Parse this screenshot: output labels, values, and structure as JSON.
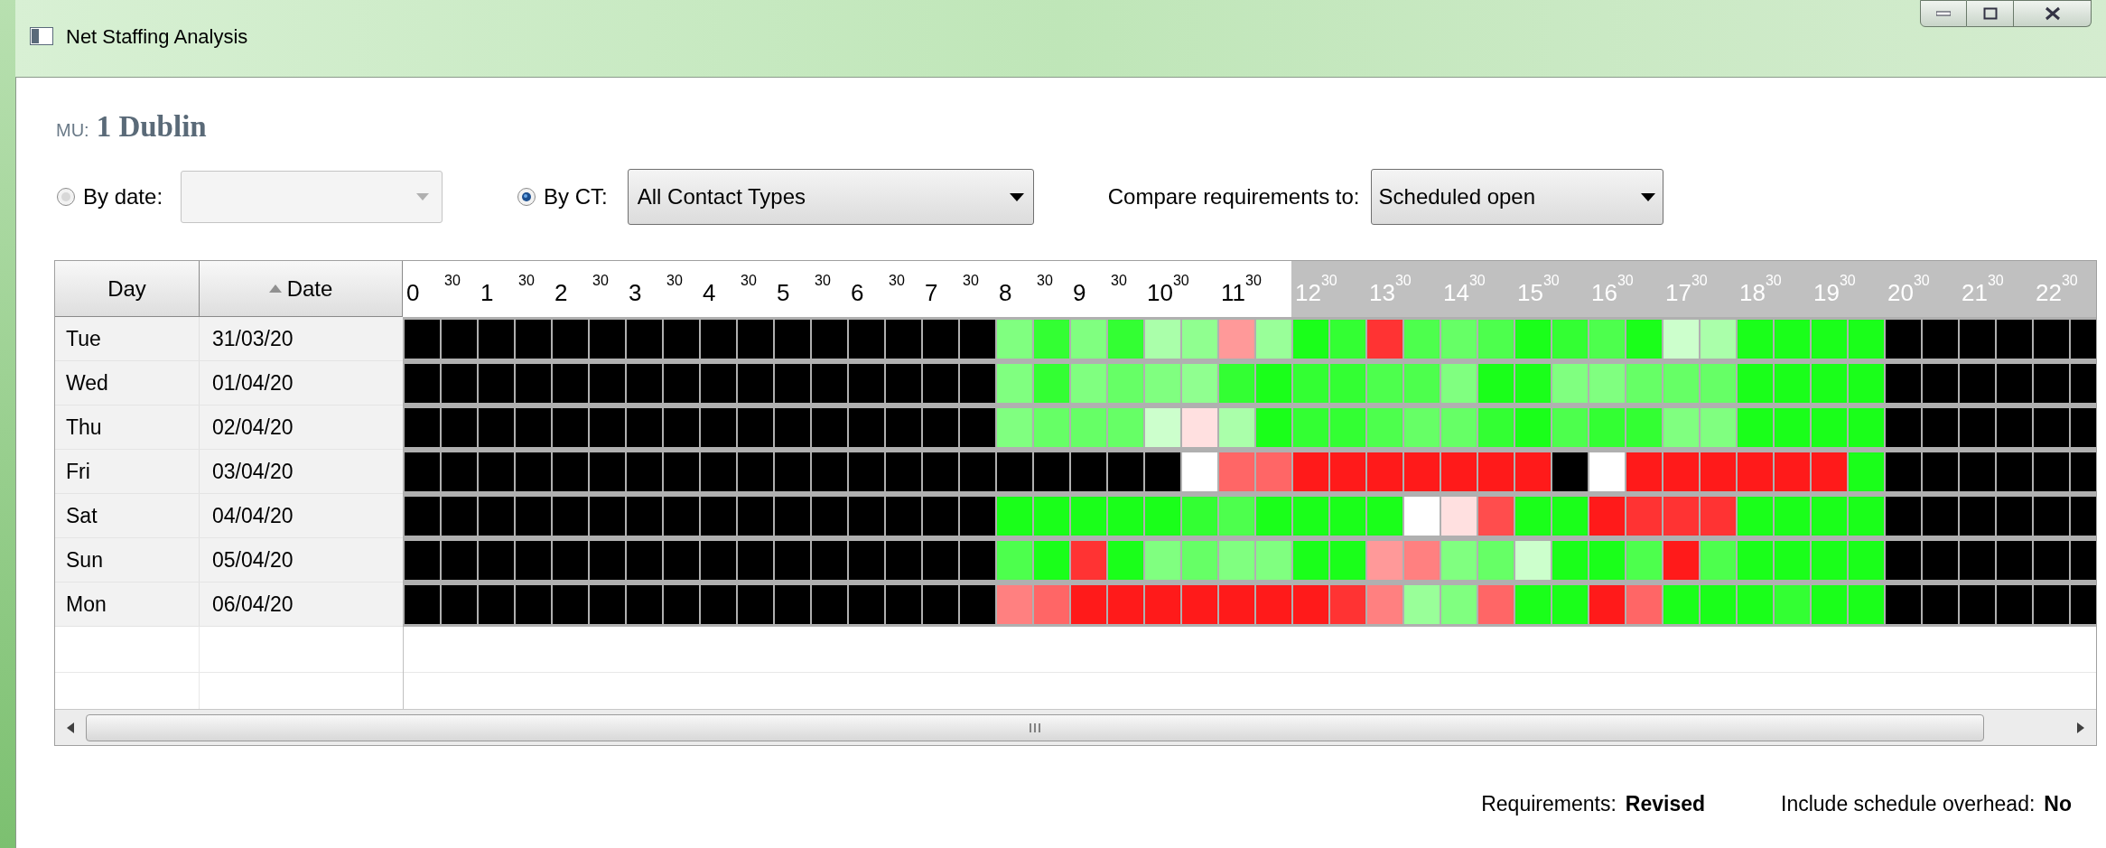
{
  "window": {
    "title": "Net Staffing Analysis"
  },
  "mu": {
    "label": "MU:",
    "value": "1 Dublin"
  },
  "by_date": {
    "label": "By date:",
    "selected": false,
    "disabled": true
  },
  "by_ct": {
    "label": "By CT:",
    "selected": true,
    "value": "All Contact Types"
  },
  "compare": {
    "label": "Compare requirements to:",
    "value": "Scheduled open"
  },
  "grid": {
    "columns": [
      {
        "label": "Day",
        "sorted": false
      },
      {
        "label": "Date",
        "sorted": true
      }
    ],
    "time_labels": [
      {
        "hour": "0",
        "minute": "30",
        "shaded": false
      },
      {
        "hour": "1",
        "minute": "30",
        "shaded": false
      },
      {
        "hour": "2",
        "minute": "30",
        "shaded": false
      },
      {
        "hour": "3",
        "minute": "30",
        "shaded": false
      },
      {
        "hour": "4",
        "minute": "30",
        "shaded": false
      },
      {
        "hour": "5",
        "minute": "30",
        "shaded": false
      },
      {
        "hour": "6",
        "minute": "30",
        "shaded": false
      },
      {
        "hour": "7",
        "minute": "30",
        "shaded": false
      },
      {
        "hour": "8",
        "minute": "30",
        "shaded": false
      },
      {
        "hour": "9",
        "minute": "30",
        "shaded": false
      },
      {
        "hour": "10",
        "minute": "30",
        "shaded": false
      },
      {
        "hour": "11",
        "minute": "30",
        "shaded": false
      },
      {
        "hour": "12",
        "minute": "30",
        "shaded": true
      },
      {
        "hour": "13",
        "minute": "30",
        "shaded": true
      },
      {
        "hour": "14",
        "minute": "30",
        "shaded": true
      },
      {
        "hour": "15",
        "minute": "30",
        "shaded": true
      },
      {
        "hour": "16",
        "minute": "30",
        "shaded": true
      },
      {
        "hour": "17",
        "minute": "30",
        "shaded": true
      },
      {
        "hour": "18",
        "minute": "30",
        "shaded": true
      },
      {
        "hour": "19",
        "minute": "30",
        "shaded": true
      },
      {
        "hour": "20",
        "minute": "30",
        "shaded": true
      },
      {
        "hour": "21",
        "minute": "30",
        "shaded": true
      },
      {
        "hour": "22",
        "minute": "30",
        "shaded": true
      }
    ],
    "rows": [
      {
        "day": "Tue",
        "date": "31/03/20",
        "cells": [
          {
            "color": "#000000"
          },
          {
            "color": "#000000"
          },
          {
            "color": "#000000"
          },
          {
            "color": "#000000"
          },
          {
            "color": "#000000"
          },
          {
            "color": "#000000"
          },
          {
            "color": "#000000"
          },
          {
            "color": "#000000"
          },
          {
            "color": "#000000"
          },
          {
            "color": "#000000"
          },
          {
            "color": "#000000"
          },
          {
            "color": "#000000"
          },
          {
            "color": "#000000"
          },
          {
            "color": "#000000"
          },
          {
            "color": "#000000"
          },
          {
            "color": "#000000"
          },
          {
            "color": "#80ff80"
          },
          {
            "color": "#33ff33"
          },
          {
            "color": "#80ff80"
          },
          {
            "color": "#33ff33"
          },
          {
            "color": "#aaffaa"
          },
          {
            "color": "#90ff90"
          },
          {
            "color": "#ff9999"
          },
          {
            "color": "#99ff99"
          },
          {
            "color": "#1aff1a"
          },
          {
            "color": "#33ff33"
          },
          {
            "color": "#ff3333"
          },
          {
            "color": "#4dff4d"
          },
          {
            "color": "#66ff66"
          },
          {
            "color": "#4dff4d"
          },
          {
            "color": "#1aff1a"
          },
          {
            "color": "#33ff33"
          },
          {
            "color": "#4dff4d"
          },
          {
            "color": "#1aff1a"
          },
          {
            "color": "#ccffcc"
          },
          {
            "color": "#aaffaa"
          },
          {
            "color": "#1aff1a"
          },
          {
            "color": "#1aff1a"
          },
          {
            "color": "#1aff1a"
          },
          {
            "color": "#1aff1a"
          },
          {
            "color": "#000000"
          },
          {
            "color": "#000000"
          },
          {
            "color": "#000000"
          },
          {
            "color": "#000000"
          },
          {
            "color": "#000000"
          },
          {
            "color": "#000000"
          }
        ]
      },
      {
        "day": "Wed",
        "date": "01/04/20",
        "cells": [
          {
            "color": "#000000"
          },
          {
            "color": "#000000"
          },
          {
            "color": "#000000"
          },
          {
            "color": "#000000"
          },
          {
            "color": "#000000"
          },
          {
            "color": "#000000"
          },
          {
            "color": "#000000"
          },
          {
            "color": "#000000"
          },
          {
            "color": "#000000"
          },
          {
            "color": "#000000"
          },
          {
            "color": "#000000"
          },
          {
            "color": "#000000"
          },
          {
            "color": "#000000"
          },
          {
            "color": "#000000"
          },
          {
            "color": "#000000"
          },
          {
            "color": "#000000"
          },
          {
            "color": "#80ff80"
          },
          {
            "color": "#33ff33"
          },
          {
            "color": "#80ff80"
          },
          {
            "color": "#66ff66"
          },
          {
            "color": "#80ff80"
          },
          {
            "color": "#90ff90"
          },
          {
            "color": "#33ff33"
          },
          {
            "color": "#1aff1a"
          },
          {
            "color": "#33ff33"
          },
          {
            "color": "#33ff33"
          },
          {
            "color": "#4dff4d"
          },
          {
            "color": "#4dff4d"
          },
          {
            "color": "#80ff80"
          },
          {
            "color": "#1aff1a"
          },
          {
            "color": "#1aff1a"
          },
          {
            "color": "#80ff80"
          },
          {
            "color": "#80ff80"
          },
          {
            "color": "#66ff66"
          },
          {
            "color": "#66ff66"
          },
          {
            "color": "#66ff66"
          },
          {
            "color": "#1aff1a"
          },
          {
            "color": "#1aff1a"
          },
          {
            "color": "#1aff1a"
          },
          {
            "color": "#1aff1a"
          },
          {
            "color": "#000000"
          },
          {
            "color": "#000000"
          },
          {
            "color": "#000000"
          },
          {
            "color": "#000000"
          },
          {
            "color": "#000000"
          },
          {
            "color": "#000000"
          }
        ]
      },
      {
        "day": "Thu",
        "date": "02/04/20",
        "cells": [
          {
            "color": "#000000"
          },
          {
            "color": "#000000"
          },
          {
            "color": "#000000"
          },
          {
            "color": "#000000"
          },
          {
            "color": "#000000"
          },
          {
            "color": "#000000"
          },
          {
            "color": "#000000"
          },
          {
            "color": "#000000"
          },
          {
            "color": "#000000"
          },
          {
            "color": "#000000"
          },
          {
            "color": "#000000"
          },
          {
            "color": "#000000"
          },
          {
            "color": "#000000"
          },
          {
            "color": "#000000"
          },
          {
            "color": "#000000"
          },
          {
            "color": "#000000"
          },
          {
            "color": "#80ff80"
          },
          {
            "color": "#66ff66"
          },
          {
            "color": "#66ff66"
          },
          {
            "color": "#66ff66"
          },
          {
            "color": "#ccffcc"
          },
          {
            "color": "#ffe0e0"
          },
          {
            "color": "#aaffaa"
          },
          {
            "color": "#1aff1a"
          },
          {
            "color": "#33ff33"
          },
          {
            "color": "#33ff33"
          },
          {
            "color": "#4dff4d"
          },
          {
            "color": "#66ff66"
          },
          {
            "color": "#66ff66"
          },
          {
            "color": "#33ff33"
          },
          {
            "color": "#1aff1a"
          },
          {
            "color": "#4dff4d"
          },
          {
            "color": "#33ff33"
          },
          {
            "color": "#33ff33"
          },
          {
            "color": "#80ff80"
          },
          {
            "color": "#80ff80"
          },
          {
            "color": "#1aff1a"
          },
          {
            "color": "#1aff1a"
          },
          {
            "color": "#1aff1a"
          },
          {
            "color": "#1aff1a"
          },
          {
            "color": "#000000"
          },
          {
            "color": "#000000"
          },
          {
            "color": "#000000"
          },
          {
            "color": "#000000"
          },
          {
            "color": "#000000"
          },
          {
            "color": "#000000"
          }
        ]
      },
      {
        "day": "Fri",
        "date": "03/04/20",
        "cells": [
          {
            "color": "#000000"
          },
          {
            "color": "#000000"
          },
          {
            "color": "#000000"
          },
          {
            "color": "#000000"
          },
          {
            "color": "#000000"
          },
          {
            "color": "#000000"
          },
          {
            "color": "#000000"
          },
          {
            "color": "#000000"
          },
          {
            "color": "#000000"
          },
          {
            "color": "#000000"
          },
          {
            "color": "#000000"
          },
          {
            "color": "#000000"
          },
          {
            "color": "#000000"
          },
          {
            "color": "#000000"
          },
          {
            "color": "#000000"
          },
          {
            "color": "#000000"
          },
          {
            "color": "#000000"
          },
          {
            "color": "#000000"
          },
          {
            "color": "#000000"
          },
          {
            "color": "#000000"
          },
          {
            "color": "#000000"
          },
          {
            "color": "#ffffff"
          },
          {
            "color": "#ff6666"
          },
          {
            "color": "#ff6666"
          },
          {
            "color": "#ff1a1a"
          },
          {
            "color": "#ff1a1a"
          },
          {
            "color": "#ff1a1a"
          },
          {
            "color": "#ff1a1a"
          },
          {
            "color": "#ff1a1a"
          },
          {
            "color": "#ff1a1a"
          },
          {
            "color": "#ff1a1a"
          },
          {
            "color": "#000000"
          },
          {
            "color": "#ffffff"
          },
          {
            "color": "#ff1a1a"
          },
          {
            "color": "#ff1a1a"
          },
          {
            "color": "#ff1a1a"
          },
          {
            "color": "#ff1a1a"
          },
          {
            "color": "#ff1a1a"
          },
          {
            "color": "#ff1a1a"
          },
          {
            "color": "#1aff1a"
          },
          {
            "color": "#000000"
          },
          {
            "color": "#000000"
          },
          {
            "color": "#000000"
          },
          {
            "color": "#000000"
          },
          {
            "color": "#000000"
          },
          {
            "color": "#000000"
          }
        ]
      },
      {
        "day": "Sat",
        "date": "04/04/20",
        "cells": [
          {
            "color": "#000000"
          },
          {
            "color": "#000000"
          },
          {
            "color": "#000000"
          },
          {
            "color": "#000000"
          },
          {
            "color": "#000000"
          },
          {
            "color": "#000000"
          },
          {
            "color": "#000000"
          },
          {
            "color": "#000000"
          },
          {
            "color": "#000000"
          },
          {
            "color": "#000000"
          },
          {
            "color": "#000000"
          },
          {
            "color": "#000000"
          },
          {
            "color": "#000000"
          },
          {
            "color": "#000000"
          },
          {
            "color": "#000000"
          },
          {
            "color": "#000000"
          },
          {
            "color": "#1aff1a"
          },
          {
            "color": "#1aff1a"
          },
          {
            "color": "#1aff1a"
          },
          {
            "color": "#1aff1a"
          },
          {
            "color": "#1aff1a"
          },
          {
            "color": "#33ff33"
          },
          {
            "color": "#4dff4d"
          },
          {
            "color": "#1aff1a"
          },
          {
            "color": "#1aff1a"
          },
          {
            "color": "#1aff1a"
          },
          {
            "color": "#1aff1a"
          },
          {
            "color": "#ffffff"
          },
          {
            "color": "#ffe0e0"
          },
          {
            "color": "#ff4d4d"
          },
          {
            "color": "#1aff1a"
          },
          {
            "color": "#1aff1a"
          },
          {
            "color": "#ff1a1a"
          },
          {
            "color": "#ff3333"
          },
          {
            "color": "#ff3333"
          },
          {
            "color": "#ff3333"
          },
          {
            "color": "#1aff1a"
          },
          {
            "color": "#1aff1a"
          },
          {
            "color": "#1aff1a"
          },
          {
            "color": "#1aff1a"
          },
          {
            "color": "#000000"
          },
          {
            "color": "#000000"
          },
          {
            "color": "#000000"
          },
          {
            "color": "#000000"
          },
          {
            "color": "#000000"
          },
          {
            "color": "#000000"
          }
        ]
      },
      {
        "day": "Sun",
        "date": "05/04/20",
        "cells": [
          {
            "color": "#000000"
          },
          {
            "color": "#000000"
          },
          {
            "color": "#000000"
          },
          {
            "color": "#000000"
          },
          {
            "color": "#000000"
          },
          {
            "color": "#000000"
          },
          {
            "color": "#000000"
          },
          {
            "color": "#000000"
          },
          {
            "color": "#000000"
          },
          {
            "color": "#000000"
          },
          {
            "color": "#000000"
          },
          {
            "color": "#000000"
          },
          {
            "color": "#000000"
          },
          {
            "color": "#000000"
          },
          {
            "color": "#000000"
          },
          {
            "color": "#000000"
          },
          {
            "color": "#4dff4d"
          },
          {
            "color": "#1aff1a"
          },
          {
            "color": "#ff3333"
          },
          {
            "color": "#1aff1a"
          },
          {
            "color": "#80ff80"
          },
          {
            "color": "#66ff66"
          },
          {
            "color": "#80ff80"
          },
          {
            "color": "#80ff80"
          },
          {
            "color": "#1aff1a"
          },
          {
            "color": "#1aff1a"
          },
          {
            "color": "#ff9999"
          },
          {
            "color": "#ff8080"
          },
          {
            "color": "#80ff80"
          },
          {
            "color": "#66ff66"
          },
          {
            "color": "#ccffcc"
          },
          {
            "color": "#1aff1a"
          },
          {
            "color": "#1aff1a"
          },
          {
            "color": "#4dff4d"
          },
          {
            "color": "#ff1a1a"
          },
          {
            "color": "#4dff4d"
          },
          {
            "color": "#1aff1a"
          },
          {
            "color": "#1aff1a"
          },
          {
            "color": "#1aff1a"
          },
          {
            "color": "#1aff1a"
          },
          {
            "color": "#000000"
          },
          {
            "color": "#000000"
          },
          {
            "color": "#000000"
          },
          {
            "color": "#000000"
          },
          {
            "color": "#000000"
          },
          {
            "color": "#000000"
          }
        ]
      },
      {
        "day": "Mon",
        "date": "06/04/20",
        "cells": [
          {
            "color": "#000000"
          },
          {
            "color": "#000000"
          },
          {
            "color": "#000000"
          },
          {
            "color": "#000000"
          },
          {
            "color": "#000000"
          },
          {
            "color": "#000000"
          },
          {
            "color": "#000000"
          },
          {
            "color": "#000000"
          },
          {
            "color": "#000000"
          },
          {
            "color": "#000000"
          },
          {
            "color": "#000000"
          },
          {
            "color": "#000000"
          },
          {
            "color": "#000000"
          },
          {
            "color": "#000000"
          },
          {
            "color": "#000000"
          },
          {
            "color": "#000000"
          },
          {
            "color": "#ff8080"
          },
          {
            "color": "#ff6666"
          },
          {
            "color": "#ff1a1a"
          },
          {
            "color": "#ff1a1a"
          },
          {
            "color": "#ff1a1a"
          },
          {
            "color": "#ff1a1a"
          },
          {
            "color": "#ff1a1a"
          },
          {
            "color": "#ff1a1a"
          },
          {
            "color": "#ff1a1a"
          },
          {
            "color": "#ff3333"
          },
          {
            "color": "#ff8080"
          },
          {
            "color": "#99ff99"
          },
          {
            "color": "#80ff80"
          },
          {
            "color": "#ff6666"
          },
          {
            "color": "#1aff1a"
          },
          {
            "color": "#1aff1a"
          },
          {
            "color": "#ff1a1a"
          },
          {
            "color": "#ff6666"
          },
          {
            "color": "#1aff1a"
          },
          {
            "color": "#1aff1a"
          },
          {
            "color": "#1aff1a"
          },
          {
            "color": "#33ff33"
          },
          {
            "color": "#1aff1a"
          },
          {
            "color": "#1aff1a"
          },
          {
            "color": "#000000"
          },
          {
            "color": "#000000"
          },
          {
            "color": "#000000"
          },
          {
            "color": "#000000"
          },
          {
            "color": "#000000"
          },
          {
            "color": "#000000"
          }
        ]
      }
    ]
  },
  "status": [
    {
      "label": "Requirements:",
      "value": "Revised"
    },
    {
      "label": "Include schedule overhead:",
      "value": "No"
    }
  ]
}
